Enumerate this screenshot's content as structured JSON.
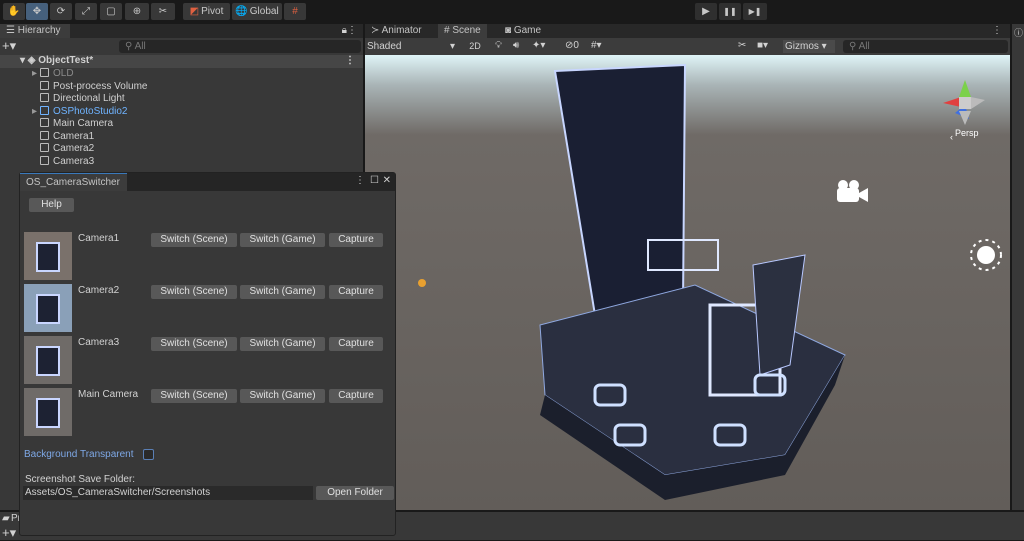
{
  "toolbar": {
    "pivot": "Pivot",
    "global": "Global",
    "tools": [
      "hand",
      "move",
      "rotate",
      "scale",
      "rect",
      "transform",
      "custom"
    ]
  },
  "hierarchy": {
    "title": "Hierarchy",
    "search_placeholder": "All",
    "scene": "ObjectTest*",
    "items": [
      {
        "label": "OLD",
        "dim": true,
        "arrow": true
      },
      {
        "label": "Post-process Volume"
      },
      {
        "label": "Directional Light"
      },
      {
        "label": "OSPhotoStudio2",
        "prefab": true,
        "arrow": true
      },
      {
        "label": "Main Camera"
      },
      {
        "label": "Camera1"
      },
      {
        "label": "Camera2"
      },
      {
        "label": "Camera3"
      }
    ]
  },
  "scene_panel": {
    "tabs": [
      "Animator",
      "Scene",
      "Game"
    ],
    "shading": "Shaded",
    "mode_2d": "2D",
    "hidden_count": "0",
    "gizmos": "Gizmos",
    "search_placeholder": "All",
    "persp": "Persp"
  },
  "bottom": {
    "project_label": "Pr"
  },
  "switcher": {
    "title": "OS_CameraSwitcher",
    "help": "Help",
    "cameras": [
      {
        "name": "Camera1"
      },
      {
        "name": "Camera2"
      },
      {
        "name": "Camera3"
      },
      {
        "name": "Main Camera"
      }
    ],
    "switch_scene": "Switch (Scene)",
    "switch_game": "Switch (Game)",
    "capture": "Capture",
    "bg_transparent_label": "Background Transparent",
    "bg_transparent": false,
    "folder_label": "Screenshot Save Folder:",
    "folder_value": "Assets/OS_CameraSwitcher/Screenshots",
    "open_folder": "Open Folder"
  },
  "play": {
    "play": "▶",
    "pause": "❚❚",
    "step": "▶❚"
  }
}
